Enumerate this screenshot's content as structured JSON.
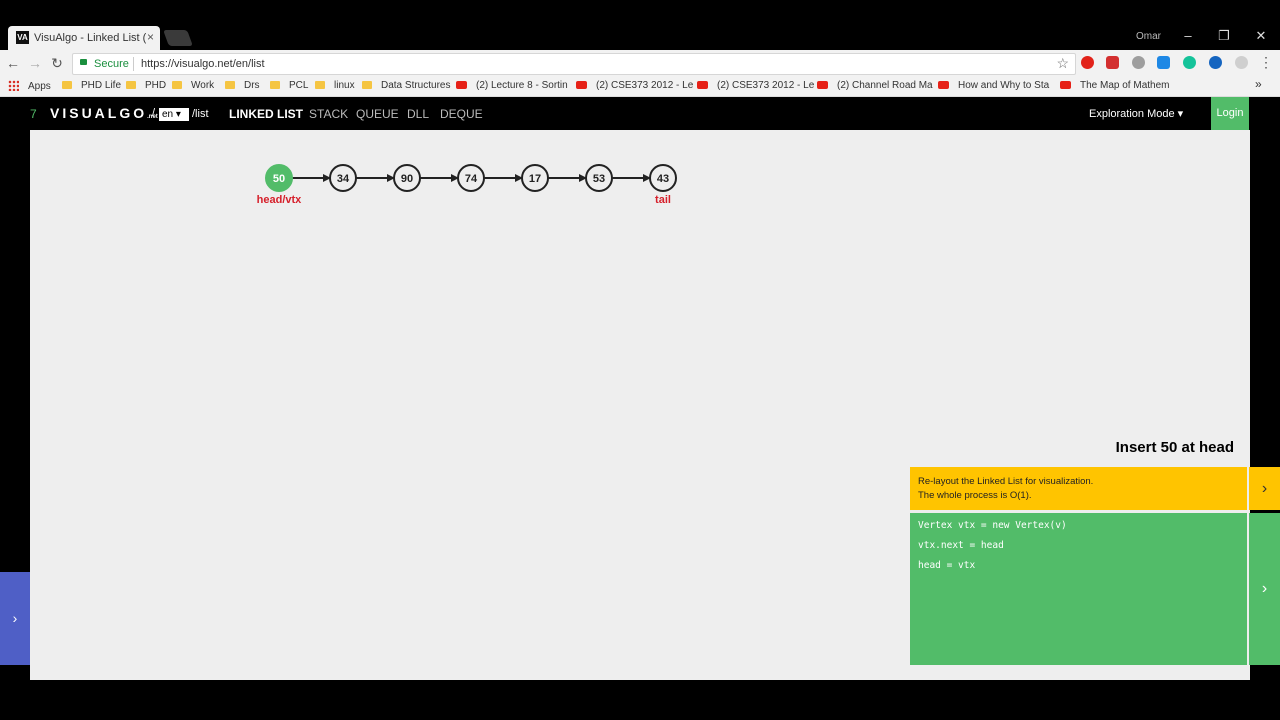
{
  "browser": {
    "tab_title": "VisuAlgo - Linked List (Si",
    "tab_favicon": "VA",
    "tab_close": "×",
    "user": "Omar",
    "window_minimize": "–",
    "window_restore": "❐",
    "window_close": "✕",
    "secure_label": "Secure",
    "url": "https://visualgo.net/en/list",
    "bookmarks": [
      {
        "icon": "apps",
        "label": "Apps"
      },
      {
        "icon": "folder",
        "label": "PHD Life"
      },
      {
        "icon": "folder",
        "label": "PHD"
      },
      {
        "icon": "folder",
        "label": "Work"
      },
      {
        "icon": "folder",
        "label": "Drs"
      },
      {
        "icon": "folder",
        "label": "PCL"
      },
      {
        "icon": "folder",
        "label": "linux"
      },
      {
        "icon": "folder",
        "label": "Data Structures"
      },
      {
        "icon": "youtube",
        "label": "(2) Lecture 8 - Sortin"
      },
      {
        "icon": "youtube",
        "label": "(2) CSE373 2012 - Le"
      },
      {
        "icon": "youtube",
        "label": "(2) CSE373 2012 - Le"
      },
      {
        "icon": "youtube",
        "label": "(2) Channel Road Ma"
      },
      {
        "icon": "youtube",
        "label": "How and Why to Sta"
      },
      {
        "icon": "youtube",
        "label": "The Map of Mathem"
      }
    ],
    "bookmarks_more": "»"
  },
  "nav": {
    "logo_number": "7",
    "logo_text": "VISUALGO",
    "logo_suffix": ".net",
    "slash": "/",
    "language": "en ▾",
    "path": "/list",
    "links": [
      "LINKED LIST",
      "STACK",
      "QUEUE",
      "DLL",
      "DEQUE"
    ],
    "active_link": "LINKED LIST",
    "mode": "Exploration Mode ▾",
    "login": "Login"
  },
  "list": {
    "nodes": [
      {
        "value": "50",
        "highlighted": true,
        "label": "head/vtx"
      },
      {
        "value": "34",
        "highlighted": false,
        "label": ""
      },
      {
        "value": "90",
        "highlighted": false,
        "label": ""
      },
      {
        "value": "74",
        "highlighted": false,
        "label": ""
      },
      {
        "value": "17",
        "highlighted": false,
        "label": ""
      },
      {
        "value": "53",
        "highlighted": false,
        "label": ""
      },
      {
        "value": "43",
        "highlighted": false,
        "label": "tail"
      }
    ]
  },
  "status": {
    "title": "Insert 50 at head",
    "message_lines": [
      "Re-layout the Linked List for visualization.",
      "The whole process is O(1)."
    ],
    "code_lines": [
      "Vertex vtx = new Vertex(v)",
      "vtx.next = head",
      "head = vtx"
    ],
    "arrow": "›"
  },
  "side_panel_arrow": "›",
  "colors": {
    "accent_green": "#52bc69",
    "label_red": "#d6202b",
    "status_yellow": "#ffc400",
    "side_panel_blue": "#4f5fc6"
  }
}
